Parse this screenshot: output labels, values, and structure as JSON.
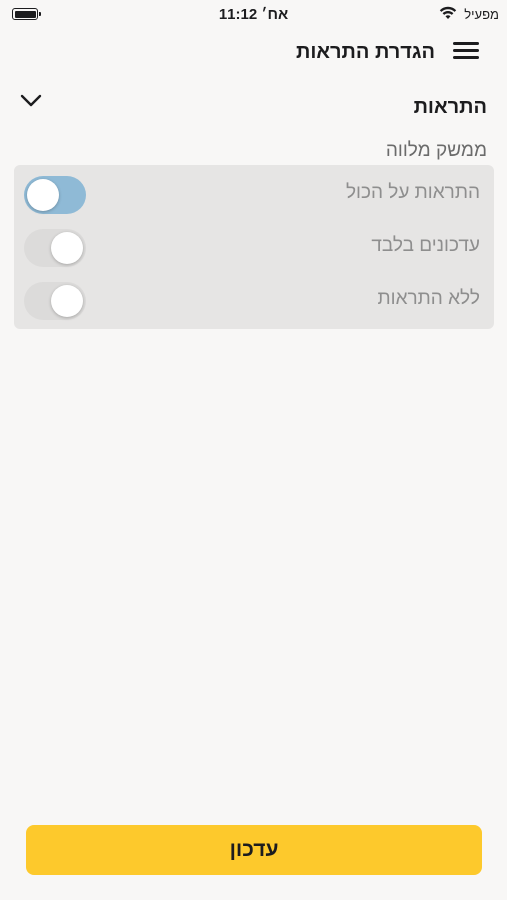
{
  "status_bar": {
    "time": "11:12 אח׳",
    "carrier": "מפעיל"
  },
  "header": {
    "title": "הגדרת התראות"
  },
  "section": {
    "title": "התראות",
    "subtitle": "ממשק מלווה"
  },
  "options": [
    {
      "label": "התראות על הכול",
      "enabled": true
    },
    {
      "label": "עדכונים בלבד",
      "enabled": false
    },
    {
      "label": "ללא התראות",
      "enabled": false
    }
  ],
  "update_button": {
    "label": "עדכון"
  },
  "colors": {
    "background": "#f8f7f6",
    "card": "#e6e5e4",
    "toggle_on": "#8fbad6",
    "toggle_off": "#dcdbda",
    "accent": "#fdc92c"
  }
}
